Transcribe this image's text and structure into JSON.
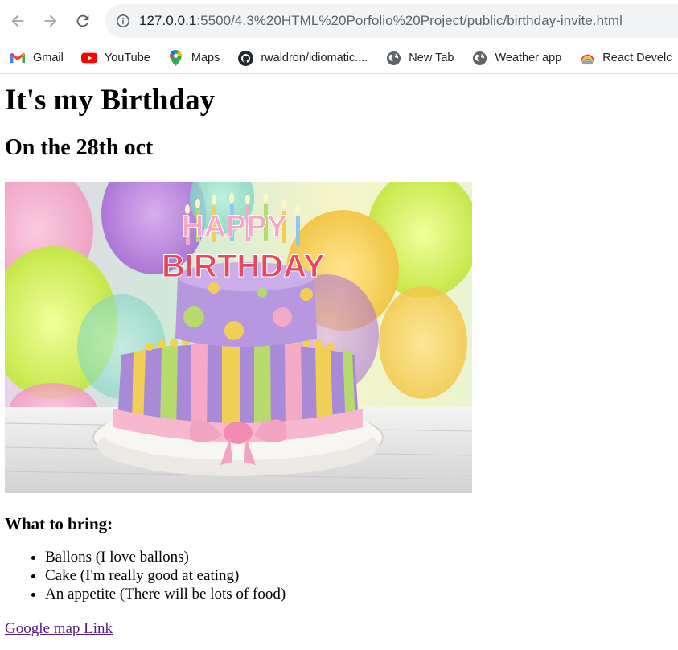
{
  "browser": {
    "url_host": "127.0.0.1",
    "url_rest": ":5500/4.3%20HTML%20Porfolio%20Project/public/birthday-invite.html",
    "bookmarks": [
      {
        "label": "Gmail",
        "icon": "gmail-icon"
      },
      {
        "label": "YouTube",
        "icon": "youtube-icon"
      },
      {
        "label": "Maps",
        "icon": "maps-icon"
      },
      {
        "label": "rwaldron/idiomatic....",
        "icon": "github-icon"
      },
      {
        "label": "New Tab",
        "icon": "globe-icon"
      },
      {
        "label": "Weather app",
        "icon": "globe-icon"
      },
      {
        "label": "React Develc",
        "icon": "rainbow-icon"
      }
    ]
  },
  "page": {
    "title": "It's my Birthday",
    "date": "On the 28th oct",
    "image_text": "HAPPY BIRTHDAY",
    "bring_heading": "What to bring:",
    "bring_items": [
      "Ballons (I love ballons)",
      "Cake (I'm really good at eating)",
      "An appetite (There will be lots of food)"
    ],
    "map_link": "Google map Link"
  },
  "colors": {
    "link_visited": "#551a8b",
    "chrome_icon": "#5f6368"
  }
}
